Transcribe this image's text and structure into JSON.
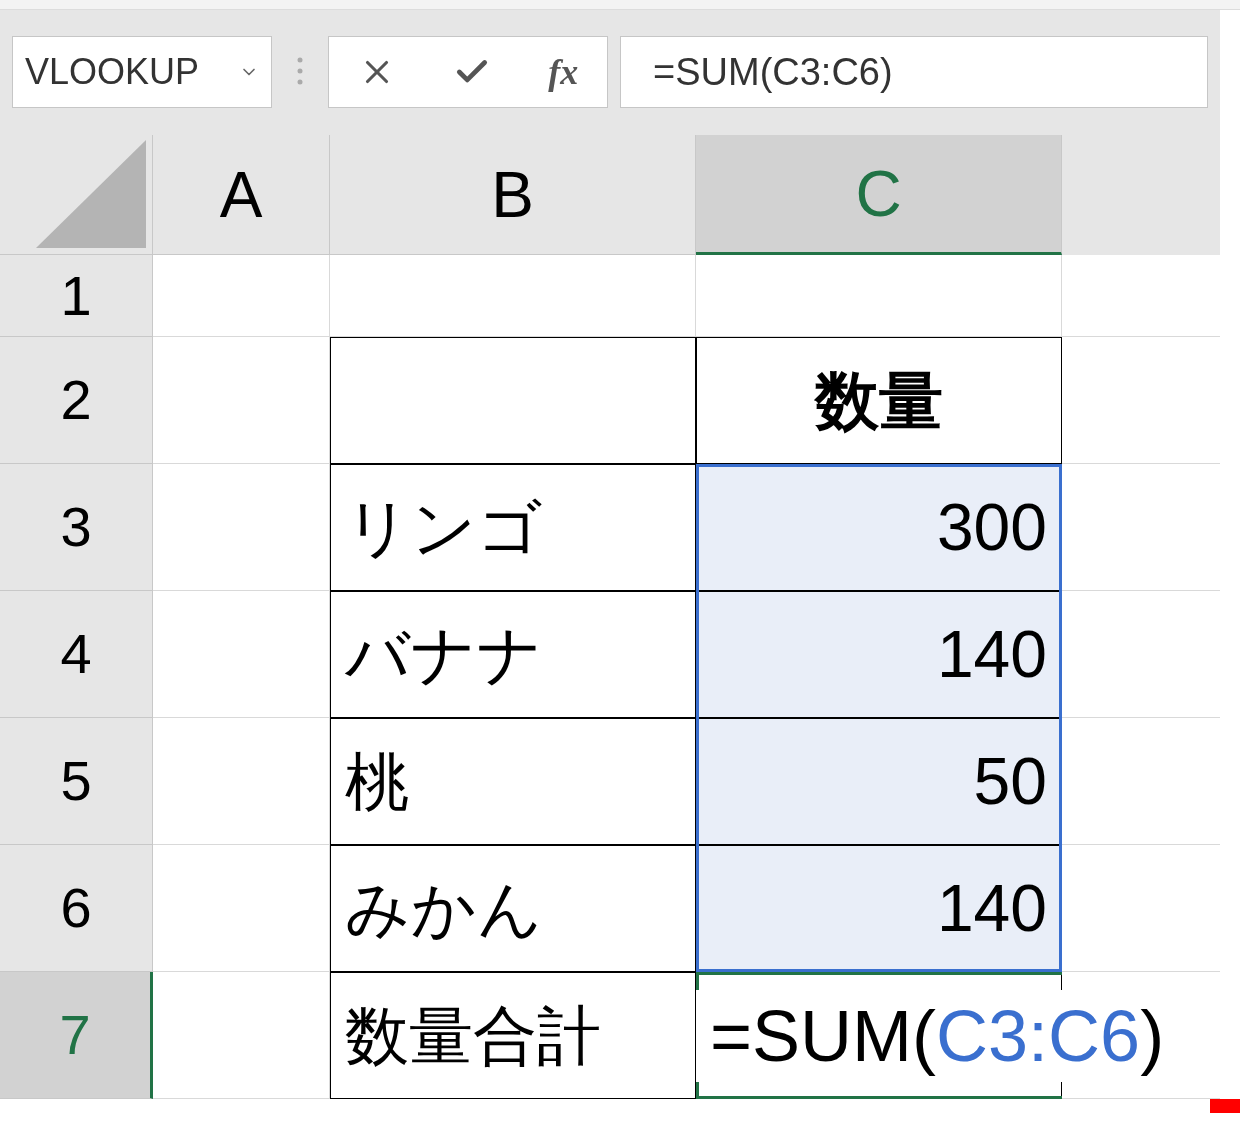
{
  "name_box": {
    "value": "VLOOKUP"
  },
  "formula_bar": {
    "fx": "fx",
    "value": "=SUM(C3:C6)"
  },
  "columns": [
    {
      "label": "A",
      "selected": false
    },
    {
      "label": "B",
      "selected": false
    },
    {
      "label": "C",
      "selected": true
    }
  ],
  "rows": [
    {
      "header": "1",
      "selected": false,
      "bordered": false,
      "cells": [
        {
          "kind": "empty"
        },
        {
          "kind": "empty"
        }
      ]
    },
    {
      "header": "2",
      "selected": false,
      "bordered": true,
      "cells": [
        {
          "kind": "empty"
        },
        {
          "kind": "heading",
          "text": "数量"
        }
      ]
    },
    {
      "header": "3",
      "selected": false,
      "bordered": true,
      "cells": [
        {
          "kind": "text",
          "text": "リンゴ"
        },
        {
          "kind": "number",
          "text": "300",
          "highlighted": true
        }
      ]
    },
    {
      "header": "4",
      "selected": false,
      "bordered": true,
      "cells": [
        {
          "kind": "text",
          "text": "バナナ"
        },
        {
          "kind": "number",
          "text": "140",
          "highlighted": true
        }
      ]
    },
    {
      "header": "5",
      "selected": false,
      "bordered": true,
      "cells": [
        {
          "kind": "text",
          "text": "桃"
        },
        {
          "kind": "number",
          "text": "50",
          "highlighted": true
        }
      ]
    },
    {
      "header": "6",
      "selected": false,
      "bordered": true,
      "cells": [
        {
          "kind": "text",
          "text": "みかん"
        },
        {
          "kind": "number",
          "text": "140",
          "highlighted": true
        }
      ]
    },
    {
      "header": "7",
      "selected": true,
      "bordered": true,
      "cells": [
        {
          "kind": "text",
          "text": "数量合計"
        },
        {
          "kind": "formula",
          "active": true,
          "parts": [
            {
              "kind": "plain",
              "text": "=SUM("
            },
            {
              "kind": "ref",
              "text": "C3:C6"
            },
            {
              "kind": "plain",
              "text": ")"
            }
          ]
        }
      ]
    }
  ]
}
